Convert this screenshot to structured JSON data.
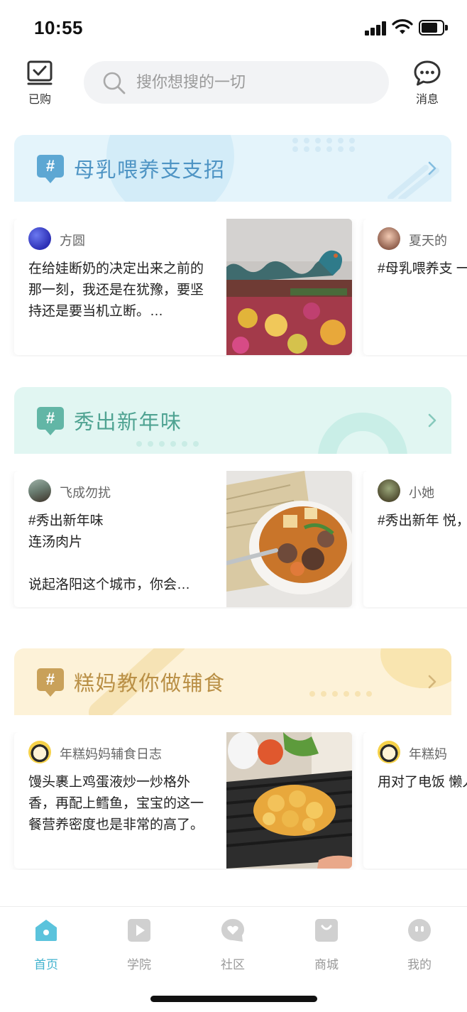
{
  "status": {
    "time": "10:55"
  },
  "header": {
    "purchased_label": "已购",
    "search_placeholder": "搜你想搜的一切",
    "messages_label": "消息"
  },
  "topics": [
    {
      "hash": "#",
      "title": "母乳喂养支支招",
      "theme": {
        "bg": "#e5f4fb",
        "accent": "#5da7d3",
        "title_color": "#4e94c4"
      },
      "cards": [
        {
          "author": "方圆",
          "avatar_icon": "blue-avatar",
          "text": "在给娃断奶的决定出来之前的那一刻，我还是在犹豫，要坚持还是要当机立断。…",
          "image": "flower-dragon-photo"
        },
        {
          "author": "夏天的",
          "avatar_icon": "child-avatar",
          "text": "#母乳喂养支\n一定是有兴\n遇到的问题\n及，那么我"
        }
      ]
    },
    {
      "hash": "#",
      "title": "秀出新年味",
      "theme": {
        "bg": "#e2f6f2",
        "accent": "#5fb4a4",
        "title_color": "#4fa392"
      },
      "cards": [
        {
          "author": "飞成勿扰",
          "avatar_icon": "landscape-avatar",
          "text": "#秀出新年味\n连汤肉片\n\n说起洛阳这个城市，你会…",
          "image": "soup-bowl-photo"
        },
        {
          "author": "小她",
          "avatar_icon": "child-avatar",
          "text": "#秀出新年\n悦，幸福，\n绕着我的心\n宝，有年糕"
        }
      ]
    },
    {
      "hash": "#",
      "title": "糕妈教你做辅食",
      "theme": {
        "bg": "#fdf3d9",
        "accent": "#c9a15a",
        "title_color": "#b98f45"
      },
      "cards": [
        {
          "author": "年糕妈妈辅食日志",
          "avatar_icon": "cartoon-mom-avatar",
          "text": "馒头裹上鸡蛋液炒一炒格外香，再配上鳕鱼，宝宝的这一餐营养密度也是非常的高了。",
          "image": "egg-bread-dish-photo"
        },
        {
          "author": "年糕妈",
          "avatar_icon": "cartoon-mom-avatar",
          "text": "用对了电饭\n懒人美食博"
        }
      ]
    }
  ],
  "tabbar": [
    {
      "label": "首页",
      "icon": "home-icon",
      "active": true
    },
    {
      "label": "学院",
      "icon": "play-icon",
      "active": false
    },
    {
      "label": "社区",
      "icon": "heart-bubble-icon",
      "active": false
    },
    {
      "label": "商城",
      "icon": "shopping-bag-icon",
      "active": false
    },
    {
      "label": "我的",
      "icon": "face-icon",
      "active": false
    }
  ]
}
